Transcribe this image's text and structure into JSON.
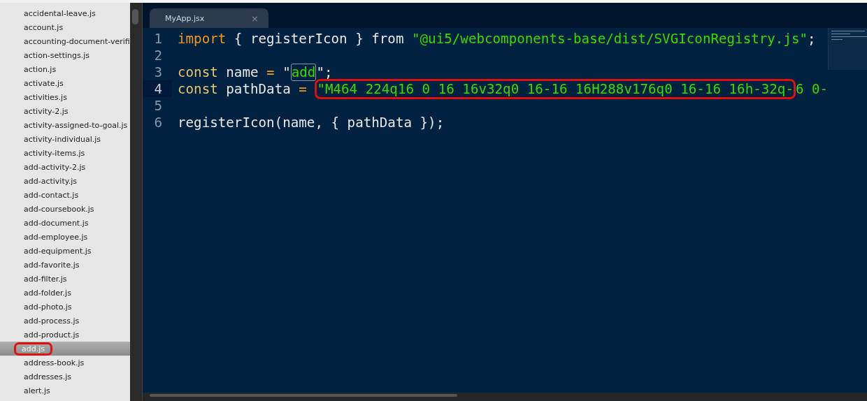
{
  "sidebar": {
    "files": [
      {
        "name": "accidental-leave.js",
        "selected": false,
        "annotated": false
      },
      {
        "name": "account.js",
        "selected": false,
        "annotated": false
      },
      {
        "name": "accounting-document-verifi",
        "selected": false,
        "annotated": false
      },
      {
        "name": "action-settings.js",
        "selected": false,
        "annotated": false
      },
      {
        "name": "action.js",
        "selected": false,
        "annotated": false
      },
      {
        "name": "activate.js",
        "selected": false,
        "annotated": false
      },
      {
        "name": "activities.js",
        "selected": false,
        "annotated": false
      },
      {
        "name": "activity-2.js",
        "selected": false,
        "annotated": false
      },
      {
        "name": "activity-assigned-to-goal.js",
        "selected": false,
        "annotated": false
      },
      {
        "name": "activity-individual.js",
        "selected": false,
        "annotated": false
      },
      {
        "name": "activity-items.js",
        "selected": false,
        "annotated": false
      },
      {
        "name": "add-activity-2.js",
        "selected": false,
        "annotated": false
      },
      {
        "name": "add-activity.js",
        "selected": false,
        "annotated": false
      },
      {
        "name": "add-contact.js",
        "selected": false,
        "annotated": false
      },
      {
        "name": "add-coursebook.js",
        "selected": false,
        "annotated": false
      },
      {
        "name": "add-document.js",
        "selected": false,
        "annotated": false
      },
      {
        "name": "add-employee.js",
        "selected": false,
        "annotated": false
      },
      {
        "name": "add-equipment.js",
        "selected": false,
        "annotated": false
      },
      {
        "name": "add-favorite.js",
        "selected": false,
        "annotated": false
      },
      {
        "name": "add-filter.js",
        "selected": false,
        "annotated": false
      },
      {
        "name": "add-folder.js",
        "selected": false,
        "annotated": false
      },
      {
        "name": "add-photo.js",
        "selected": false,
        "annotated": false
      },
      {
        "name": "add-process.js",
        "selected": false,
        "annotated": false
      },
      {
        "name": "add-product.js",
        "selected": false,
        "annotated": false
      },
      {
        "name": "add.js",
        "selected": true,
        "annotated": true
      },
      {
        "name": "address-book.js",
        "selected": false,
        "annotated": false
      },
      {
        "name": "addresses.js",
        "selected": false,
        "annotated": false
      },
      {
        "name": "alert.js",
        "selected": false,
        "annotated": false
      }
    ]
  },
  "tabs": [
    {
      "label": "MyApp.jsx",
      "close": "×",
      "selected": true
    }
  ],
  "editor": {
    "lines": [
      {
        "number": "1",
        "current": false,
        "tokens": [
          {
            "kind": "keyword",
            "text": "import"
          },
          {
            "kind": "plain",
            "text": " { registerIcon } from "
          },
          {
            "kind": "string",
            "text": "\"@ui5/webcomponents-base/dist/SVGIconRegistry.js\""
          },
          {
            "kind": "plain",
            "text": ";"
          }
        ]
      },
      {
        "number": "2",
        "current": false
      },
      {
        "number": "3",
        "current": false,
        "tokens": [
          {
            "kind": "storage",
            "text": "const"
          },
          {
            "kind": "plain",
            "text": " name "
          },
          {
            "kind": "operator",
            "text": "="
          },
          {
            "kind": "plain",
            "text": " \""
          },
          {
            "kind": "boxed",
            "text": "add"
          },
          {
            "kind": "plain",
            "text": "\";"
          }
        ]
      },
      {
        "number": "4",
        "current": true,
        "tokens": [
          {
            "kind": "storage",
            "text": "const"
          },
          {
            "kind": "plain",
            "text": " pathData "
          },
          {
            "kind": "operator",
            "text": "= "
          },
          {
            "kind": "annotated",
            "text": "\"M464 224q16 0 16 16v32q0 16-16 16H288v176q0 16-16 16h-32q-"
          },
          {
            "kind": "string",
            "text": "6 0-"
          }
        ]
      },
      {
        "number": "5",
        "current": false
      },
      {
        "number": "6",
        "current": false,
        "tokens": [
          {
            "kind": "plain",
            "text": "registerIcon(name, { pathData });"
          }
        ]
      }
    ]
  }
}
